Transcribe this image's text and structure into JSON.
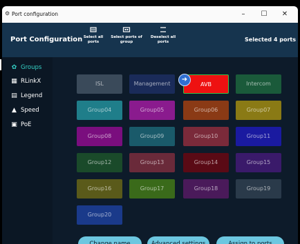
{
  "window": {
    "title": "Port configuration"
  },
  "header": {
    "title": "Port Configuration",
    "buttons": [
      {
        "label": "Select all ports",
        "icon": "select-all-icon"
      },
      {
        "label": "Select ports of group",
        "icon": "select-group-icon"
      },
      {
        "label": "Deselect all ports",
        "icon": "deselect-icon"
      }
    ],
    "selected_text": "Selected 4 ports"
  },
  "sidebar": {
    "items": [
      {
        "label": "Groups",
        "icon": "groups-icon",
        "active": true
      },
      {
        "label": "RLinkX",
        "icon": "rlinkx-icon",
        "active": false
      },
      {
        "label": "Legend",
        "icon": "legend-icon",
        "active": false
      },
      {
        "label": "Speed",
        "icon": "speed-icon",
        "active": false
      },
      {
        "label": "PoE",
        "icon": "poe-icon",
        "active": false
      }
    ]
  },
  "groups": [
    {
      "label": "ISL",
      "color": "#3a4a5a"
    },
    {
      "label": "Management",
      "color": "#1a2b59"
    },
    {
      "label": "AVB",
      "color": "#ee1111",
      "selected": true
    },
    {
      "label": "Intercom",
      "color": "#1a5a3a"
    },
    {
      "label": "Group04",
      "color": "#1f7e8a"
    },
    {
      "label": "Group05",
      "color": "#8a1b8e"
    },
    {
      "label": "Group06",
      "color": "#8a3a15"
    },
    {
      "label": "Group07",
      "color": "#8a7a15"
    },
    {
      "label": "Group08",
      "color": "#7a0e7e"
    },
    {
      "label": "Group09",
      "color": "#1a5a6a"
    },
    {
      "label": "Group10",
      "color": "#7a2a3a"
    },
    {
      "label": "Group11",
      "color": "#1a1aa0"
    },
    {
      "label": "Group12",
      "color": "#1a4a2a"
    },
    {
      "label": "Group13",
      "color": "#6a2a3a"
    },
    {
      "label": "Group14",
      "color": "#5a0a15"
    },
    {
      "label": "Group15",
      "color": "#3a1a6a"
    },
    {
      "label": "Group16",
      "color": "#5a5a1a"
    },
    {
      "label": "Group17",
      "color": "#3a6a1a"
    },
    {
      "label": "Group18",
      "color": "#4a1a5a"
    },
    {
      "label": "Group19",
      "color": "#2a3a4a"
    },
    {
      "label": "Group20",
      "color": "#1a3a8a"
    }
  ],
  "badge_icon": "link-icon",
  "actions": {
    "change_name": "Change name",
    "advanced": "Advanced settings",
    "assign": "Assign to ports"
  }
}
